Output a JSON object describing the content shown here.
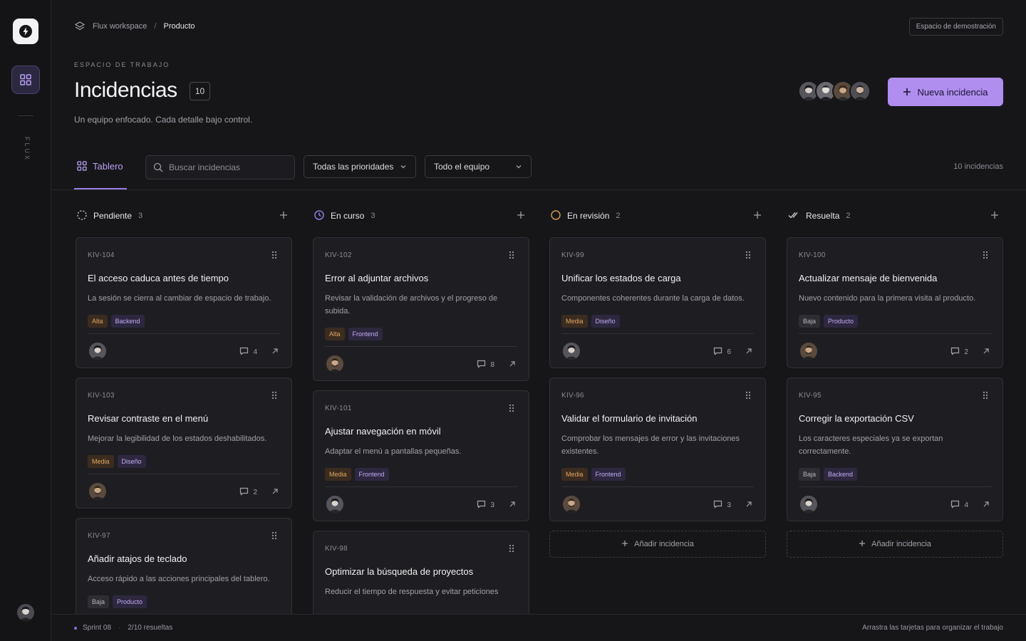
{
  "rail": {
    "brand_vertical": "FLUX"
  },
  "breadcrumb": {
    "workspace": "Flux workspace",
    "separator": "/",
    "current": "Producto"
  },
  "header": {
    "demo_badge": "Espacio de demostración",
    "eyebrow": "ESPACIO DE TRABAJO",
    "title": "Incidencias",
    "count": "10",
    "subtitle": "Un equipo enfocado. Cada detalle bajo control.",
    "new_button": "Nueva incidencia"
  },
  "toolbar": {
    "tab_board": "Tablero",
    "search_placeholder": "Buscar incidencias",
    "priority_filter": "Todas las prioridades",
    "team_filter": "Todo el equipo",
    "total": "10 incidencias"
  },
  "colors": {
    "accent": "#b08ef0",
    "alta": "#d79b5a",
    "media": "#d79b5a",
    "baja": "#a9a9b3",
    "label": "#b49ce8"
  },
  "columns": [
    {
      "name": "Pendiente",
      "count": "3",
      "icon": "dashed-circle-icon",
      "cards": [
        {
          "id": "KIV-104",
          "title": "El acceso caduca antes de tiempo",
          "desc": "La sesión se cierra al cambiar de espacio de trabajo.",
          "priority": "Alta",
          "label": "Backend",
          "comments": "4"
        },
        {
          "id": "KIV-103",
          "title": "Revisar contraste en el menú",
          "desc": "Mejorar la legibilidad de los estados deshabilitados.",
          "priority": "Media",
          "label": "Diseño",
          "comments": "2"
        },
        {
          "id": "KIV-97",
          "title": "Añadir atajos de teclado",
          "desc": "Acceso rápido a las acciones principales del tablero.",
          "priority": "Baja",
          "label": "Producto",
          "comments": ""
        }
      ]
    },
    {
      "name": "En curso",
      "count": "3",
      "icon": "clock-icon",
      "cards": [
        {
          "id": "KIV-102",
          "title": "Error al adjuntar archivos",
          "desc": "Revisar la validación de archivos y el progreso de subida.",
          "priority": "Alta",
          "label": "Frontend",
          "comments": "8"
        },
        {
          "id": "KIV-101",
          "title": "Ajustar navegación en móvil",
          "desc": "Adaptar el menú a pantallas pequeñas.",
          "priority": "Media",
          "label": "Frontend",
          "comments": "3"
        },
        {
          "id": "KIV-98",
          "title": "Optimizar la búsqueda de proyectos",
          "desc": "Reducir el tiempo de respuesta y evitar peticiones",
          "priority": "",
          "label": "",
          "comments": ""
        }
      ]
    },
    {
      "name": "En revisión",
      "count": "2",
      "icon": "circle-icon",
      "cards": [
        {
          "id": "KIV-99",
          "title": "Unificar los estados de carga",
          "desc": "Componentes coherentes durante la carga de datos.",
          "priority": "Media",
          "label": "Diseño",
          "comments": "6"
        },
        {
          "id": "KIV-96",
          "title": "Validar el formulario de invitación",
          "desc": "Comprobar los mensajes de error y las invitaciones existentes.",
          "priority": "Media",
          "label": "Frontend",
          "comments": "3"
        }
      ],
      "add": "Añadir incidencia"
    },
    {
      "name": "Resuelta",
      "count": "2",
      "icon": "double-check-icon",
      "cards": [
        {
          "id": "KIV-100",
          "title": "Actualizar mensaje de bienvenida",
          "desc": "Nuevo contenido para la primera visita al producto.",
          "priority": "Baja",
          "label": "Producto",
          "comments": "2"
        },
        {
          "id": "KIV-95",
          "title": "Corregir la exportación CSV",
          "desc": "Los caracteres especiales ya se exportan correctamente.",
          "priority": "Baja",
          "label": "Backend",
          "comments": "4"
        }
      ],
      "add": "Añadir incidencia"
    }
  ],
  "footer": {
    "sprint": "Sprint 08",
    "separator": "·",
    "progress": "2/10 resueltas",
    "hint": "Arrastra las tarjetas para organizar el trabajo"
  }
}
